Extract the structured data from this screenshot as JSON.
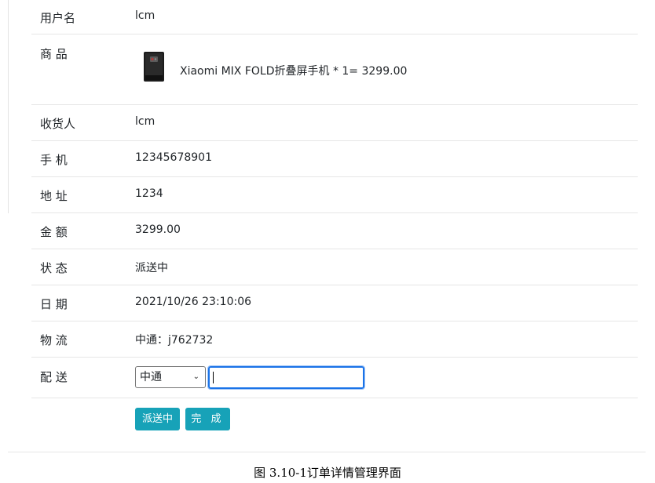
{
  "order": {
    "username_label": "用户名",
    "username_value": "lcm",
    "product_label": "商 品",
    "product_text": "Xiaomi MIX FOLD折叠屏手机 * 1= 3299.00",
    "receiver_label": "收货人",
    "receiver_value": "lcm",
    "phone_label": "手 机",
    "phone_value": "12345678901",
    "address_label": "地 址",
    "address_value": "1234",
    "amount_label": "金 额",
    "amount_value": "3299.00",
    "status_label": "状 态",
    "status_value": "派送中",
    "date_label": "日 期",
    "date_value": "2021/10/26 23:10:06",
    "logistics_label": "物 流",
    "logistics_value": "中通：j762732",
    "delivery_label": "配 送"
  },
  "delivery_form": {
    "carrier_selected": "中通",
    "tracking_value": ""
  },
  "actions": {
    "dispatch_label": "派送中",
    "complete_label": "完 成"
  },
  "caption": "图 3.10-1订单详情管理界面",
  "colors": {
    "button_bg": "#17a2b8",
    "focus_border": "#1a73e8"
  }
}
